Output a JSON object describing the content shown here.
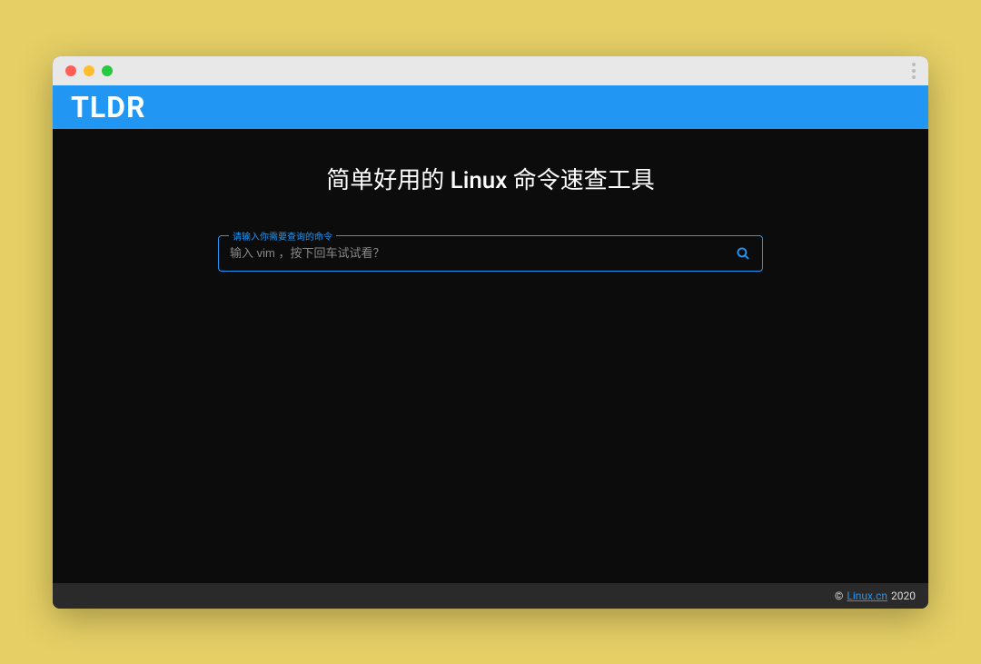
{
  "logo": "TLDR",
  "headline": "简单好用的 Linux 命令速查工具",
  "search": {
    "legend": "请输入你需要查询的命令",
    "placeholder": "输入 vim ，按下回车试试看？"
  },
  "footer": {
    "copyright": "©",
    "link_text": "Linux.cn",
    "year": "2020"
  }
}
